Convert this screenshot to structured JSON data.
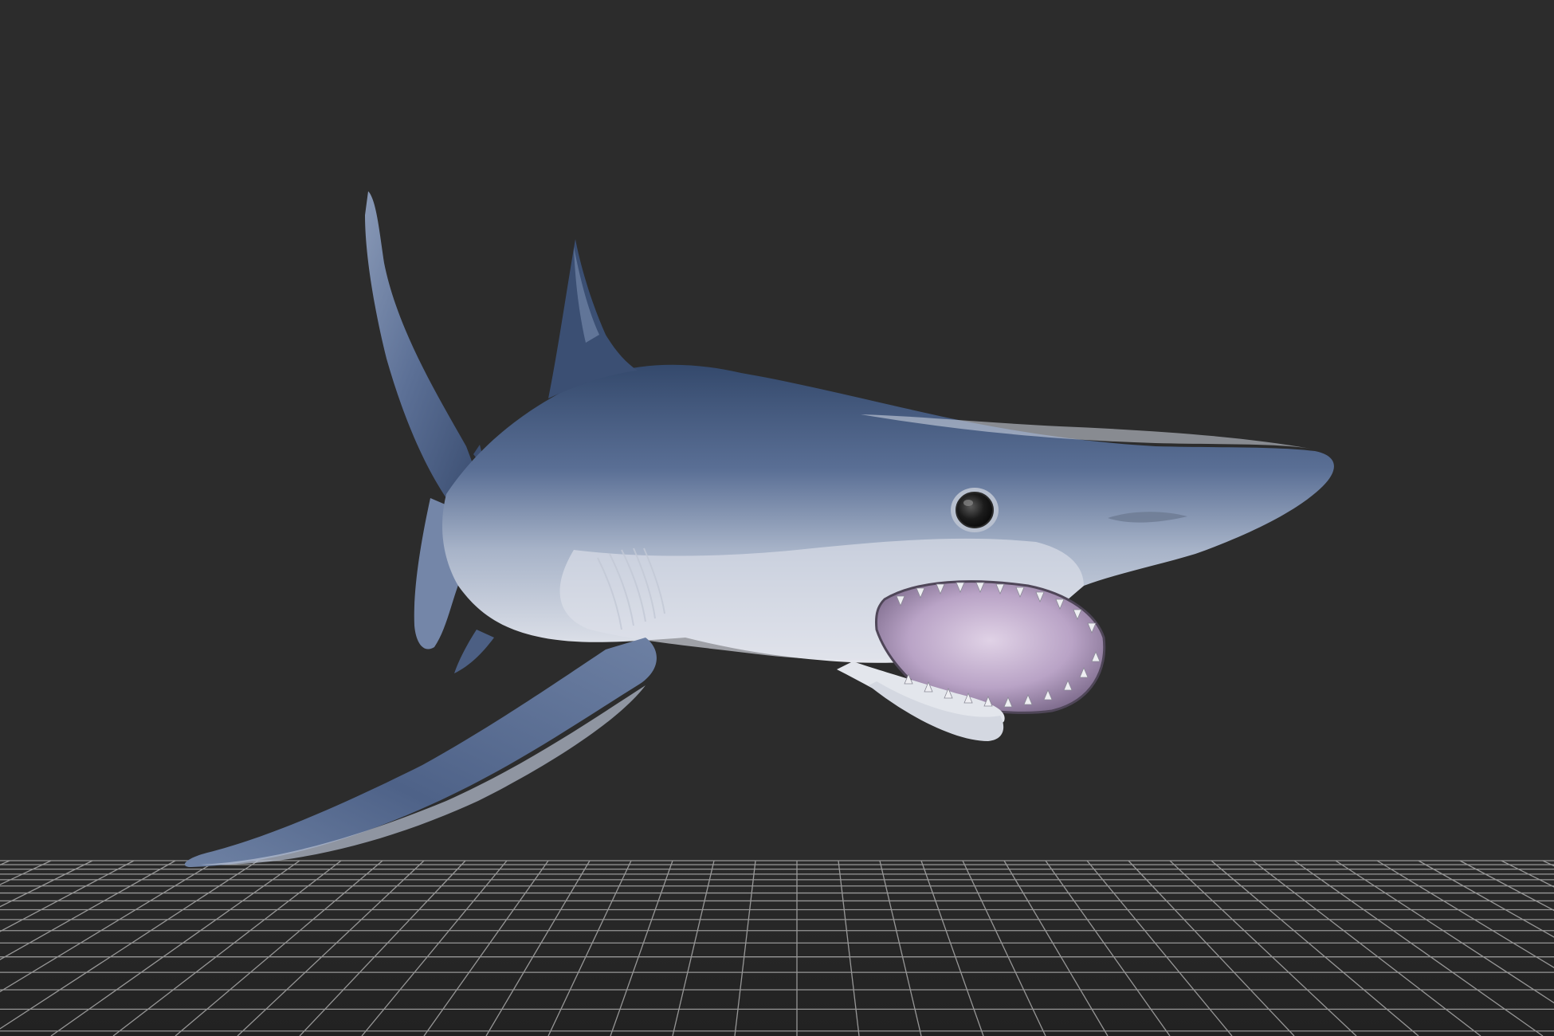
{
  "viewport": {
    "background_color": "#2c2c2c",
    "grid_line_color": "#bdbdbd",
    "grid_floor_color": "#262626"
  },
  "model": {
    "subject": "shark",
    "body_color_top": "#3c5278",
    "body_color_mid": "#7f91b0",
    "belly_color": "#e4e6ec",
    "mouth_color": "#c9b4d2",
    "eye_color": "#1a1a1a"
  }
}
